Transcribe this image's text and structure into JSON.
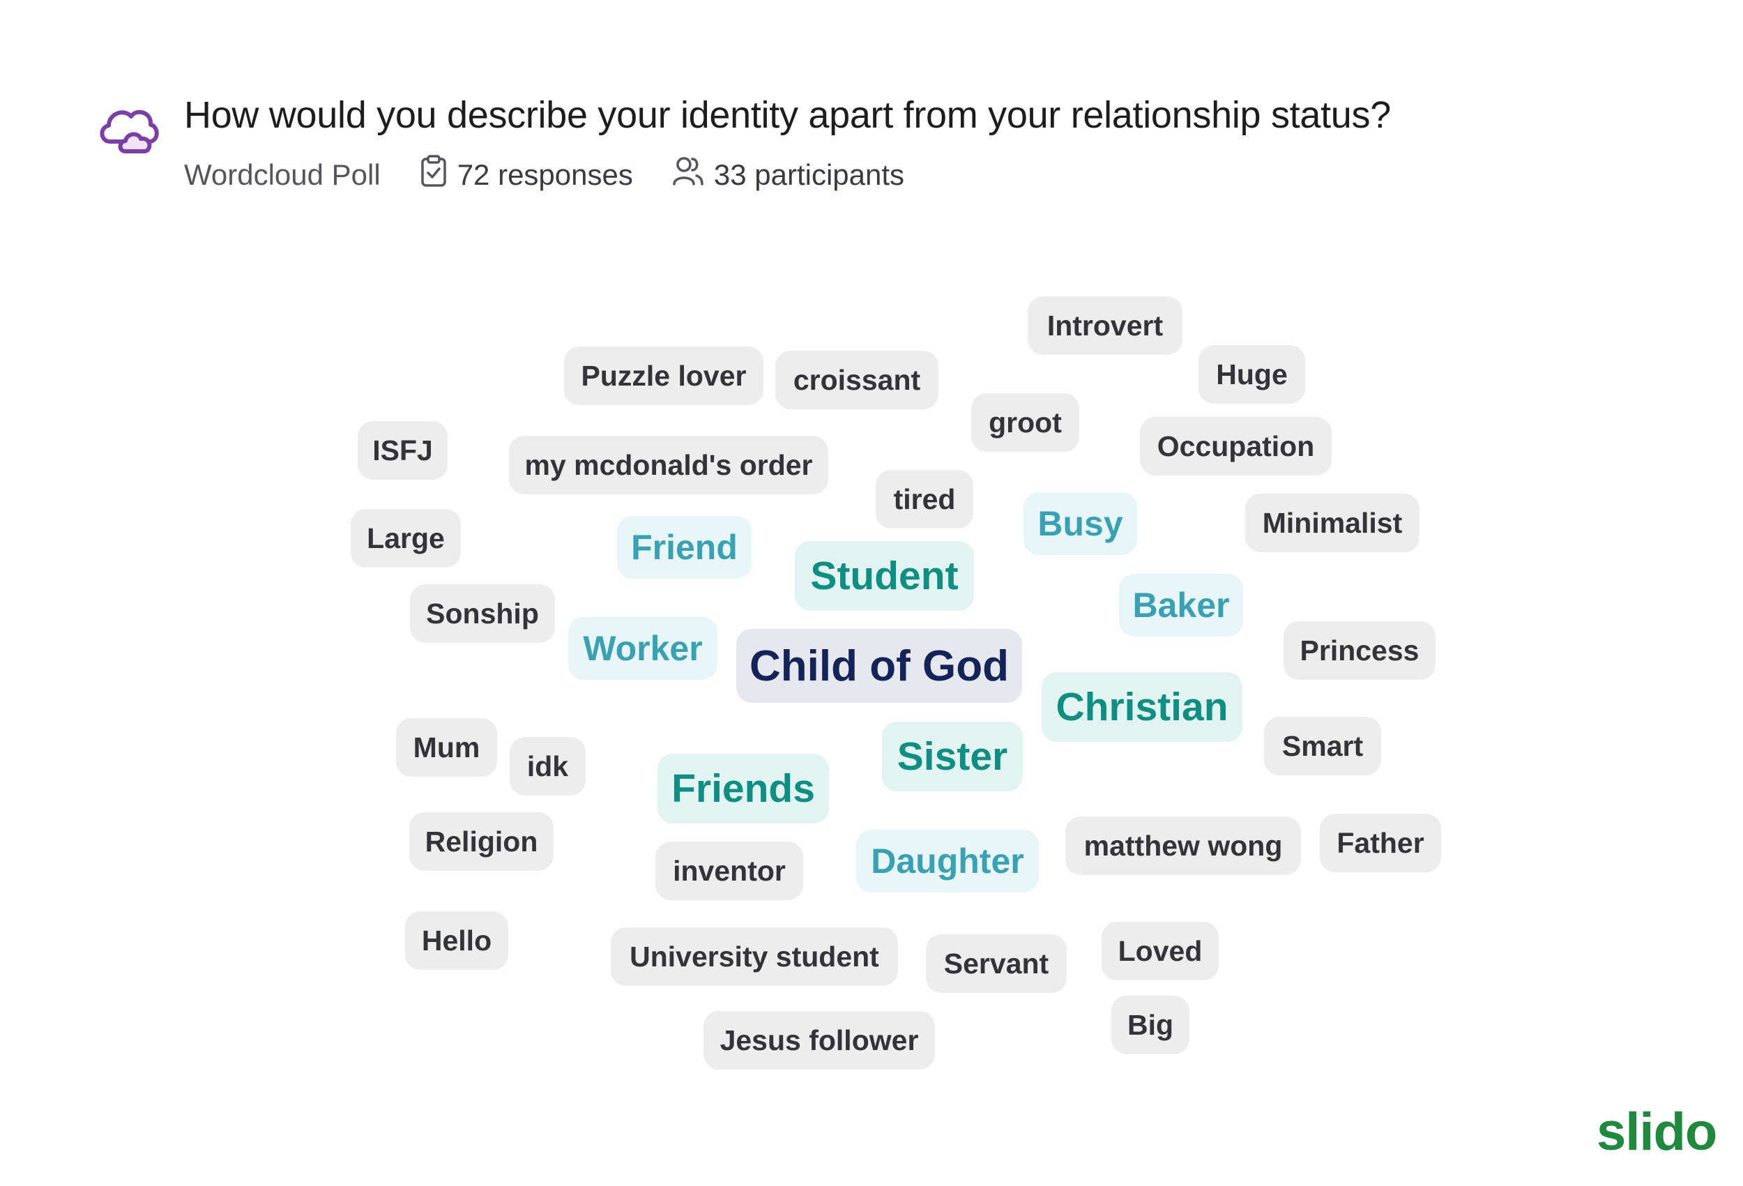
{
  "poll": {
    "question": "How would you describe your identity apart from your relationship status?",
    "type": "Wordcloud Poll",
    "responses": "72 responses",
    "participants": "33 participants",
    "icons": [
      "wordcloud-icon",
      "clipboard-check-icon",
      "people-icon"
    ]
  },
  "colors": {
    "weight0": "#333437",
    "weight1": "#3aa1b3",
    "weight2": "#0f8f82",
    "weight3": "#142458",
    "brand": "#1f8a3d",
    "icon": "#7b3fa6"
  },
  "words": [
    {
      "text": "Introvert",
      "weight": 0
    },
    {
      "text": "Puzzle lover",
      "weight": 0
    },
    {
      "text": "croissant",
      "weight": 0
    },
    {
      "text": "Huge",
      "weight": 0
    },
    {
      "text": "groot",
      "weight": 0
    },
    {
      "text": "ISFJ",
      "weight": 0
    },
    {
      "text": "my mcdonald's order",
      "weight": 0
    },
    {
      "text": "Occupation",
      "weight": 0
    },
    {
      "text": "tired",
      "weight": 0
    },
    {
      "text": "Busy",
      "weight": 1
    },
    {
      "text": "Minimalist",
      "weight": 0
    },
    {
      "text": "Large",
      "weight": 0
    },
    {
      "text": "Friend",
      "weight": 1
    },
    {
      "text": "Student",
      "weight": 2
    },
    {
      "text": "Baker",
      "weight": 1
    },
    {
      "text": "Sonship",
      "weight": 0
    },
    {
      "text": "Worker",
      "weight": 1
    },
    {
      "text": "Child of God",
      "weight": 3
    },
    {
      "text": "Princess",
      "weight": 0
    },
    {
      "text": "Christian",
      "weight": 2
    },
    {
      "text": "Mum",
      "weight": 0
    },
    {
      "text": "idk",
      "weight": 0
    },
    {
      "text": "Sister",
      "weight": 2
    },
    {
      "text": "Smart",
      "weight": 0
    },
    {
      "text": "Friends",
      "weight": 2
    },
    {
      "text": "Religion",
      "weight": 0
    },
    {
      "text": "matthew wong",
      "weight": 0
    },
    {
      "text": "Father",
      "weight": 0
    },
    {
      "text": "inventor",
      "weight": 0
    },
    {
      "text": "Daughter",
      "weight": 1
    },
    {
      "text": "Hello",
      "weight": 0
    },
    {
      "text": "University student",
      "weight": 0
    },
    {
      "text": "Servant",
      "weight": 0
    },
    {
      "text": "Loved",
      "weight": 0
    },
    {
      "text": "Jesus follower",
      "weight": 0
    },
    {
      "text": "Big",
      "weight": 0
    }
  ],
  "brand": {
    "logo": "slido"
  }
}
